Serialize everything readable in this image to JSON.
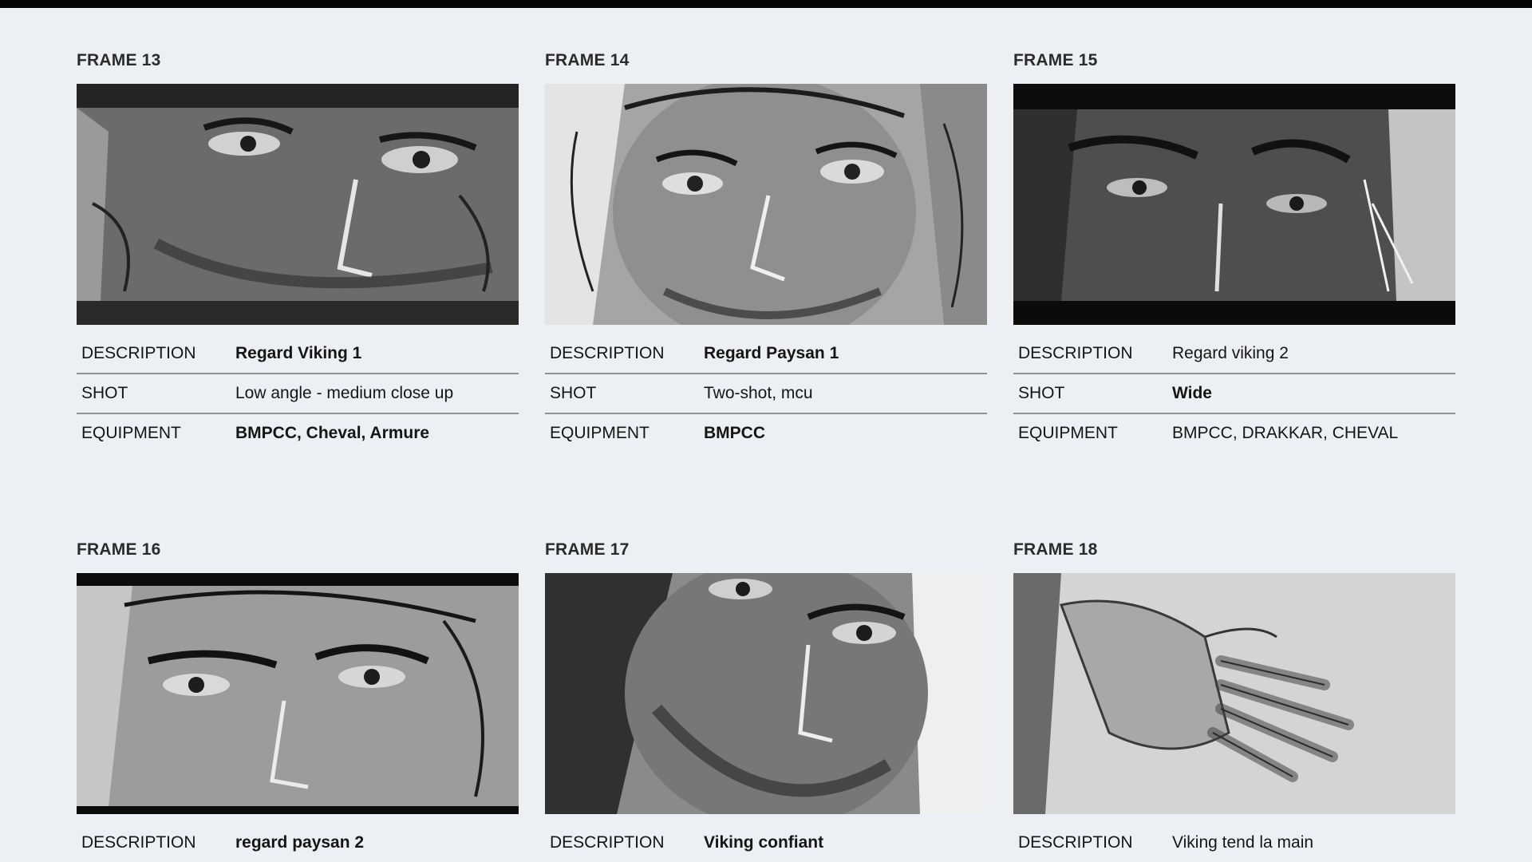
{
  "labels": {
    "description": "DESCRIPTION",
    "shot": "SHOT",
    "equipment": "EQUIPMENT"
  },
  "frames": [
    {
      "title": "FRAME 13",
      "image": "sketch-viking-eyes-closeup",
      "description": "Regard Viking 1",
      "shot": "Low angle - medium close up",
      "equipment": "BMPCC, Cheval, Armure"
    },
    {
      "title": "FRAME 14",
      "image": "sketch-peasant-face-closeup",
      "description": "Regard Paysan 1",
      "shot": "Two-shot, mcu",
      "equipment": "BMPCC"
    },
    {
      "title": "FRAME 15",
      "image": "sketch-viking-eyes-closeup-2",
      "description": "Regard viking 2",
      "shot": "Wide",
      "equipment": "BMPCC, DRAKKAR, CHEVAL"
    },
    {
      "title": "FRAME 16",
      "image": "sketch-peasant-eyes-closeup",
      "description": "regard paysan 2"
    },
    {
      "title": "FRAME 17",
      "image": "sketch-viking-confident-face",
      "description": "Viking confiant"
    },
    {
      "title": "FRAME 18",
      "image": "sketch-hand-reaching",
      "description": "Viking tend la main"
    }
  ]
}
